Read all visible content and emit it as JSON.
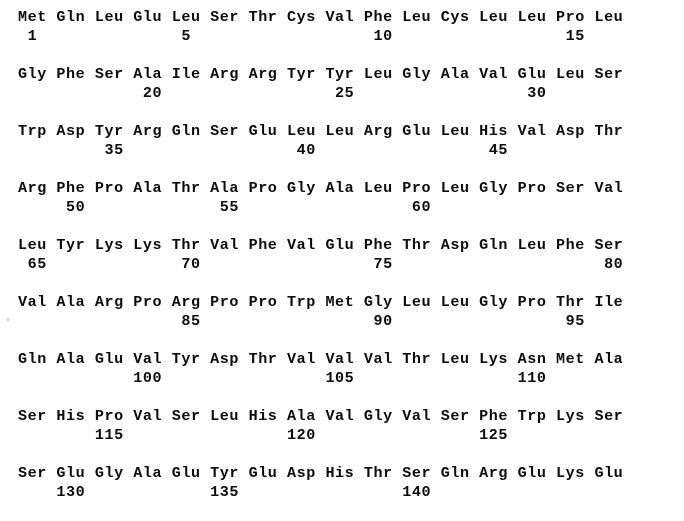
{
  "document": {
    "type": "protein-sequence-listing",
    "residues_per_row": 16,
    "total_rows": 9,
    "numbering_interval": 5,
    "text_color": "#0d0d0d",
    "background_color": "#ffffff"
  },
  "rows": [
    {
      "residues": [
        "Met",
        "Gln",
        "Leu",
        "Glu",
        "Leu",
        "Ser",
        "Thr",
        "Cys",
        "Val",
        "Phe",
        "Leu",
        "Cys",
        "Leu",
        "Leu",
        "Pro",
        "Leu"
      ],
      "numbers": [
        "1",
        "",
        "",
        "",
        "5",
        "",
        "",
        "",
        "",
        "10",
        "",
        "",
        "",
        "",
        "15",
        ""
      ],
      "number_line": "  1                 5                                  10                                  15"
    },
    {
      "residues": [
        "Gly",
        "Phe",
        "Ser",
        "Ala",
        "Ile",
        "Arg",
        "Arg",
        "Tyr",
        "Tyr",
        "Leu",
        "Gly",
        "Ala",
        "Val",
        "Glu",
        "Leu",
        "Ser"
      ],
      "numbers": [
        "",
        "",
        "",
        "20",
        "",
        "",
        "",
        "",
        "25",
        "",
        "",
        "",
        "",
        "30",
        "",
        ""
      ],
      "number_line": "                 20                  25                                  30"
    },
    {
      "residues": [
        "Trp",
        "Asp",
        "Tyr",
        "Arg",
        "Gln",
        "Ser",
        "Glu",
        "Leu",
        "Leu",
        "Arg",
        "Glu",
        "Leu",
        "His",
        "Val",
        "Asp",
        "Thr"
      ],
      "numbers": [
        "",
        "",
        "35",
        "",
        "",
        "",
        "",
        "40",
        "",
        "",
        "",
        "",
        "45",
        "",
        "",
        ""
      ],
      "number_line": "         35                  40                                  45"
    },
    {
      "residues": [
        "Arg",
        "Phe",
        "Pro",
        "Ala",
        "Thr",
        "Ala",
        "Pro",
        "Gly",
        "Ala",
        "Leu",
        "Pro",
        "Leu",
        "Gly",
        "Pro",
        "Ser",
        "Val"
      ],
      "numbers": [
        "",
        "50",
        "",
        "",
        "",
        "55",
        "",
        "",
        "",
        "",
        "60",
        "",
        "",
        "",
        "",
        ""
      ],
      "number_line": "     50                  55                                  60"
    },
    {
      "residues": [
        "Leu",
        "Tyr",
        "Lys",
        "Lys",
        "Thr",
        "Val",
        "Phe",
        "Val",
        "Glu",
        "Phe",
        "Thr",
        "Asp",
        "Gln",
        "Leu",
        "Phe",
        "Ser"
      ],
      "numbers": [
        "65",
        "",
        "",
        "",
        "70",
        "",
        "",
        "",
        "",
        "75",
        "",
        "",
        "",
        "",
        "",
        "80"
      ],
      "number_line": " 65                 70                                  75                                      80"
    },
    {
      "residues": [
        "Val",
        "Ala",
        "Arg",
        "Pro",
        "Arg",
        "Pro",
        "Pro",
        "Trp",
        "Met",
        "Gly",
        "Leu",
        "Leu",
        "Gly",
        "Pro",
        "Thr",
        "Ile"
      ],
      "numbers": [
        "",
        "",
        "",
        "",
        "85",
        "",
        "",
        "",
        "",
        "90",
        "",
        "",
        "",
        "",
        "95",
        ""
      ],
      "number_line": "                 85                  90                                  95"
    },
    {
      "residues": [
        "Gln",
        "Ala",
        "Glu",
        "Val",
        "Tyr",
        "Asp",
        "Thr",
        "Val",
        "Val",
        "Val",
        "Thr",
        "Leu",
        "Lys",
        "Asn",
        "Met",
        "Ala"
      ],
      "numbers": [
        "",
        "",
        "",
        "100",
        "",
        "",
        "",
        "",
        "105",
        "",
        "",
        "",
        "",
        "110",
        "",
        ""
      ],
      "number_line": "                100                 105                                 110"
    },
    {
      "residues": [
        "Ser",
        "His",
        "Pro",
        "Val",
        "Ser",
        "Leu",
        "His",
        "Ala",
        "Val",
        "Gly",
        "Val",
        "Ser",
        "Phe",
        "Trp",
        "Lys",
        "Ser"
      ],
      "numbers": [
        "",
        "",
        "115",
        "",
        "",
        "",
        "",
        "120",
        "",
        "",
        "",
        "",
        "125",
        "",
        "",
        ""
      ],
      "number_line": "        115                 120                                 125"
    },
    {
      "residues": [
        "Ser",
        "Glu",
        "Gly",
        "Ala",
        "Glu",
        "Tyr",
        "Glu",
        "Asp",
        "His",
        "Thr",
        "Ser",
        "Gln",
        "Arg",
        "Glu",
        "Lys",
        "Glu"
      ],
      "numbers": [
        "",
        "130",
        "",
        "",
        "",
        "135",
        "",
        "",
        "",
        "",
        "140",
        "",
        "",
        "",
        "",
        ""
      ],
      "number_line": "    130                 135                                 140"
    }
  ],
  "sequence_flat": [
    "Met",
    "Gln",
    "Leu",
    "Glu",
    "Leu",
    "Ser",
    "Thr",
    "Cys",
    "Val",
    "Phe",
    "Leu",
    "Cys",
    "Leu",
    "Leu",
    "Pro",
    "Leu",
    "Gly",
    "Phe",
    "Ser",
    "Ala",
    "Ile",
    "Arg",
    "Arg",
    "Tyr",
    "Tyr",
    "Leu",
    "Gly",
    "Ala",
    "Val",
    "Glu",
    "Leu",
    "Ser",
    "Trp",
    "Asp",
    "Tyr",
    "Arg",
    "Gln",
    "Ser",
    "Glu",
    "Leu",
    "Leu",
    "Arg",
    "Glu",
    "Leu",
    "His",
    "Val",
    "Asp",
    "Thr",
    "Arg",
    "Phe",
    "Pro",
    "Ala",
    "Thr",
    "Ala",
    "Pro",
    "Gly",
    "Ala",
    "Leu",
    "Pro",
    "Leu",
    "Gly",
    "Pro",
    "Ser",
    "Val",
    "Leu",
    "Tyr",
    "Lys",
    "Lys",
    "Thr",
    "Val",
    "Phe",
    "Val",
    "Glu",
    "Phe",
    "Thr",
    "Asp",
    "Gln",
    "Leu",
    "Phe",
    "Ser",
    "Val",
    "Ala",
    "Arg",
    "Pro",
    "Arg",
    "Pro",
    "Pro",
    "Trp",
    "Met",
    "Gly",
    "Leu",
    "Leu",
    "Gly",
    "Pro",
    "Thr",
    "Ile",
    "Gln",
    "Ala",
    "Glu",
    "Val",
    "Tyr",
    "Asp",
    "Thr",
    "Val",
    "Val",
    "Val",
    "Thr",
    "Leu",
    "Lys",
    "Asn",
    "Met",
    "Ala",
    "Ser",
    "His",
    "Pro",
    "Val",
    "Ser",
    "Leu",
    "His",
    "Ala",
    "Val",
    "Gly",
    "Val",
    "Ser",
    "Phe",
    "Trp",
    "Lys",
    "Ser",
    "Ser",
    "Glu",
    "Gly",
    "Ala",
    "Glu",
    "Tyr",
    "Glu",
    "Asp",
    "His",
    "Thr",
    "Ser",
    "Gln",
    "Arg",
    "Glu",
    "Lys",
    "Glu"
  ]
}
